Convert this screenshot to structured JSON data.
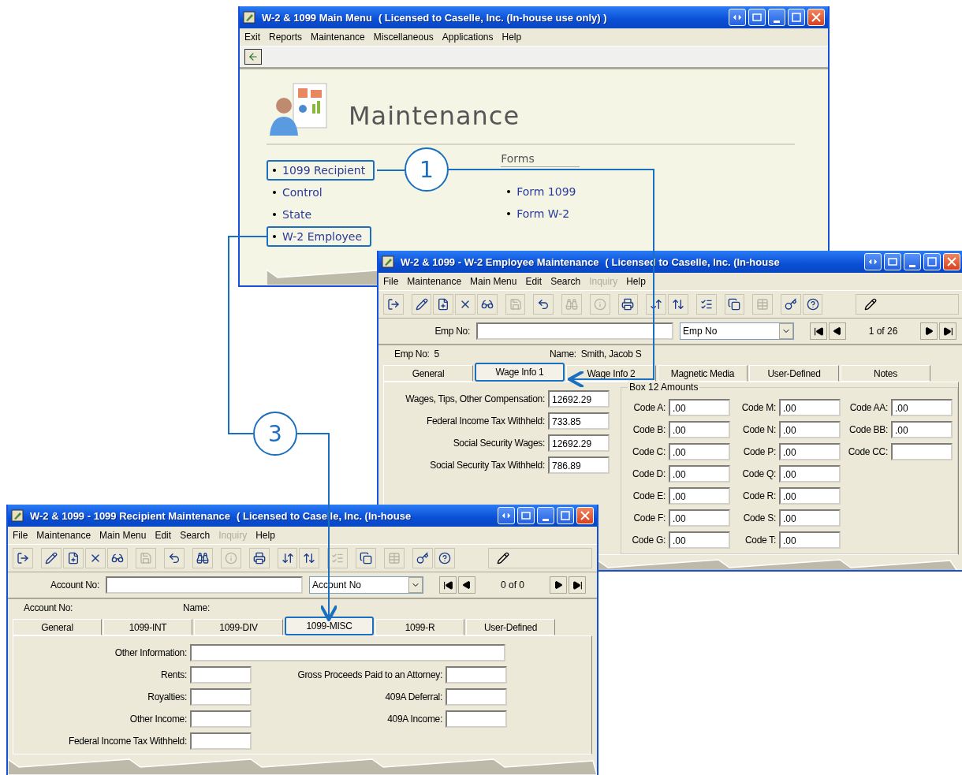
{
  "main_menu": {
    "title": "W-2 & 1099 Main Menu",
    "license": "( Licensed to Caselle, Inc. (In-house use only) )",
    "menu": [
      {
        "label": "Exit",
        "disabled": false
      },
      {
        "label": "Reports",
        "disabled": false
      },
      {
        "label": "Maintenance",
        "disabled": false
      },
      {
        "label": "Miscellaneous",
        "disabled": false
      },
      {
        "label": "Applications",
        "disabled": false
      },
      {
        "label": "Help",
        "disabled": false
      }
    ],
    "heading": "Maintenance",
    "links": [
      {
        "label": "1099 Recipient",
        "highlighted": true
      },
      {
        "label": "Control",
        "highlighted": false
      },
      {
        "label": "State",
        "highlighted": false
      },
      {
        "label": "W-2 Employee",
        "highlighted": true
      }
    ],
    "forms_heading": "Forms",
    "forms": [
      "Form 1099",
      "Form W-2"
    ]
  },
  "employee_window": {
    "title": "W-2 & 1099 - W-2 Employee Maintenance",
    "license": "( Licensed to Caselle, Inc. (In-house",
    "menu": [
      {
        "label": "File",
        "disabled": false
      },
      {
        "label": "Maintenance",
        "disabled": false
      },
      {
        "label": "Main Menu",
        "disabled": false
      },
      {
        "label": "Edit",
        "disabled": false
      },
      {
        "label": "Search",
        "disabled": false
      },
      {
        "label": "Inquiry",
        "disabled": true
      },
      {
        "label": "Help",
        "disabled": false
      }
    ],
    "toolbar": [
      {
        "disabled": false
      },
      {
        "disabled": false
      },
      {
        "disabled": false
      },
      {
        "disabled": false
      },
      {
        "disabled": false
      },
      {
        "disabled": true
      },
      {
        "disabled": false
      },
      {
        "disabled": true
      },
      {
        "disabled": true
      },
      {
        "disabled": false
      },
      {
        "disabled": false
      },
      {
        "disabled": false
      },
      {
        "disabled": false
      },
      {
        "disabled": false
      },
      {
        "disabled": true
      },
      {
        "disabled": false
      },
      {
        "disabled": false
      }
    ],
    "search": {
      "label": "Emp No:",
      "sort": "Emp No",
      "position": "1 of 26"
    },
    "record": [
      {
        "label": "Emp No:",
        "value": "5"
      },
      {
        "label": "Name:",
        "value": "Smith, Jacob S"
      }
    ],
    "tabs": [
      {
        "label": "General",
        "selected": false
      },
      {
        "label": "Wage Info 1",
        "selected": true
      },
      {
        "label": "Wage Info 2",
        "selected": false
      },
      {
        "label": "Magnetic Media",
        "selected": false
      },
      {
        "label": "User-Defined",
        "selected": false
      },
      {
        "label": "Notes",
        "selected": false
      }
    ],
    "wages": [
      {
        "label": "Wages, Tips, Other Compensation:",
        "value": "12692.29"
      },
      {
        "label": "Federal Income Tax Withheld:",
        "value": "733.85"
      },
      {
        "label": "Social Security Wages:",
        "value": "12692.29"
      },
      {
        "label": "Social Security Tax Withheld:",
        "value": "786.89"
      }
    ],
    "box12": {
      "title": "Box 12 Amounts",
      "columns": [
        [
          {
            "label": "Code A:",
            "value": ".00"
          },
          {
            "label": "Code B:",
            "value": ".00"
          },
          {
            "label": "Code C:",
            "value": ".00"
          },
          {
            "label": "Code D:",
            "value": ".00"
          },
          {
            "label": "Code E:",
            "value": ".00"
          },
          {
            "label": "Code F:",
            "value": ".00"
          },
          {
            "label": "Code G:",
            "value": ".00"
          }
        ],
        [
          {
            "label": "Code M:",
            "value": ".00"
          },
          {
            "label": "Code N:",
            "value": ".00"
          },
          {
            "label": "Code P:",
            "value": ".00"
          },
          {
            "label": "Code Q:",
            "value": ".00"
          },
          {
            "label": "Code R:",
            "value": ".00"
          },
          {
            "label": "Code S:",
            "value": ".00"
          },
          {
            "label": "Code T:",
            "value": ".00"
          }
        ],
        [
          {
            "label": "Code AA:",
            "value": ".00"
          },
          {
            "label": "Code BB:",
            "value": ".00"
          },
          {
            "label": "Code CC:"
          }
        ]
      ]
    }
  },
  "recipient_window": {
    "title": "W-2 & 1099 - 1099 Recipient Maintenance",
    "license": "( Licensed to Caselle, Inc. (In-house",
    "menu": [
      {
        "label": "File",
        "disabled": false
      },
      {
        "label": "Maintenance",
        "disabled": false
      },
      {
        "label": "Main Menu",
        "disabled": false
      },
      {
        "label": "Edit",
        "disabled": false
      },
      {
        "label": "Search",
        "disabled": false
      },
      {
        "label": "Inquiry",
        "disabled": true
      },
      {
        "label": "Help",
        "disabled": false
      }
    ],
    "toolbar": [
      {
        "disabled": false
      },
      {
        "disabled": false
      },
      {
        "disabled": false
      },
      {
        "disabled": false
      },
      {
        "disabled": false
      },
      {
        "disabled": true
      },
      {
        "disabled": false
      },
      {
        "disabled": false
      },
      {
        "disabled": true
      },
      {
        "disabled": false
      },
      {
        "disabled": false
      },
      {
        "disabled": false
      },
      {
        "disabled": true
      },
      {
        "disabled": false
      },
      {
        "disabled": true
      },
      {
        "disabled": false
      },
      {
        "disabled": false
      }
    ],
    "search": {
      "label": "Account No:",
      "sort": "Account No",
      "position": "0 of 0"
    },
    "record": [
      {
        "label": "Account No:"
      },
      {
        "label": "Name:"
      }
    ],
    "tabs": [
      {
        "label": "General",
        "selected": false
      },
      {
        "label": "1099-INT",
        "selected": false
      },
      {
        "label": "1099-DIV",
        "selected": false
      },
      {
        "label": "1099-MISC",
        "selected": true
      },
      {
        "label": "1099-R",
        "selected": false
      },
      {
        "label": "User-Defined",
        "selected": false
      }
    ],
    "other_information": {
      "label": "Other Information:"
    },
    "left_fields": [
      {
        "label": "Rents:"
      },
      {
        "label": "Royalties:"
      },
      {
        "label": "Other Income:"
      },
      {
        "label": "Federal Income Tax Withheld:"
      }
    ],
    "right_fields": [
      {
        "label": "Gross Proceeds Paid to an Attorney:"
      },
      {
        "label": "409A Deferral:"
      },
      {
        "label": "409A Income:"
      }
    ]
  },
  "callouts": [
    {
      "label": "1"
    },
    {
      "label": "3"
    }
  ]
}
